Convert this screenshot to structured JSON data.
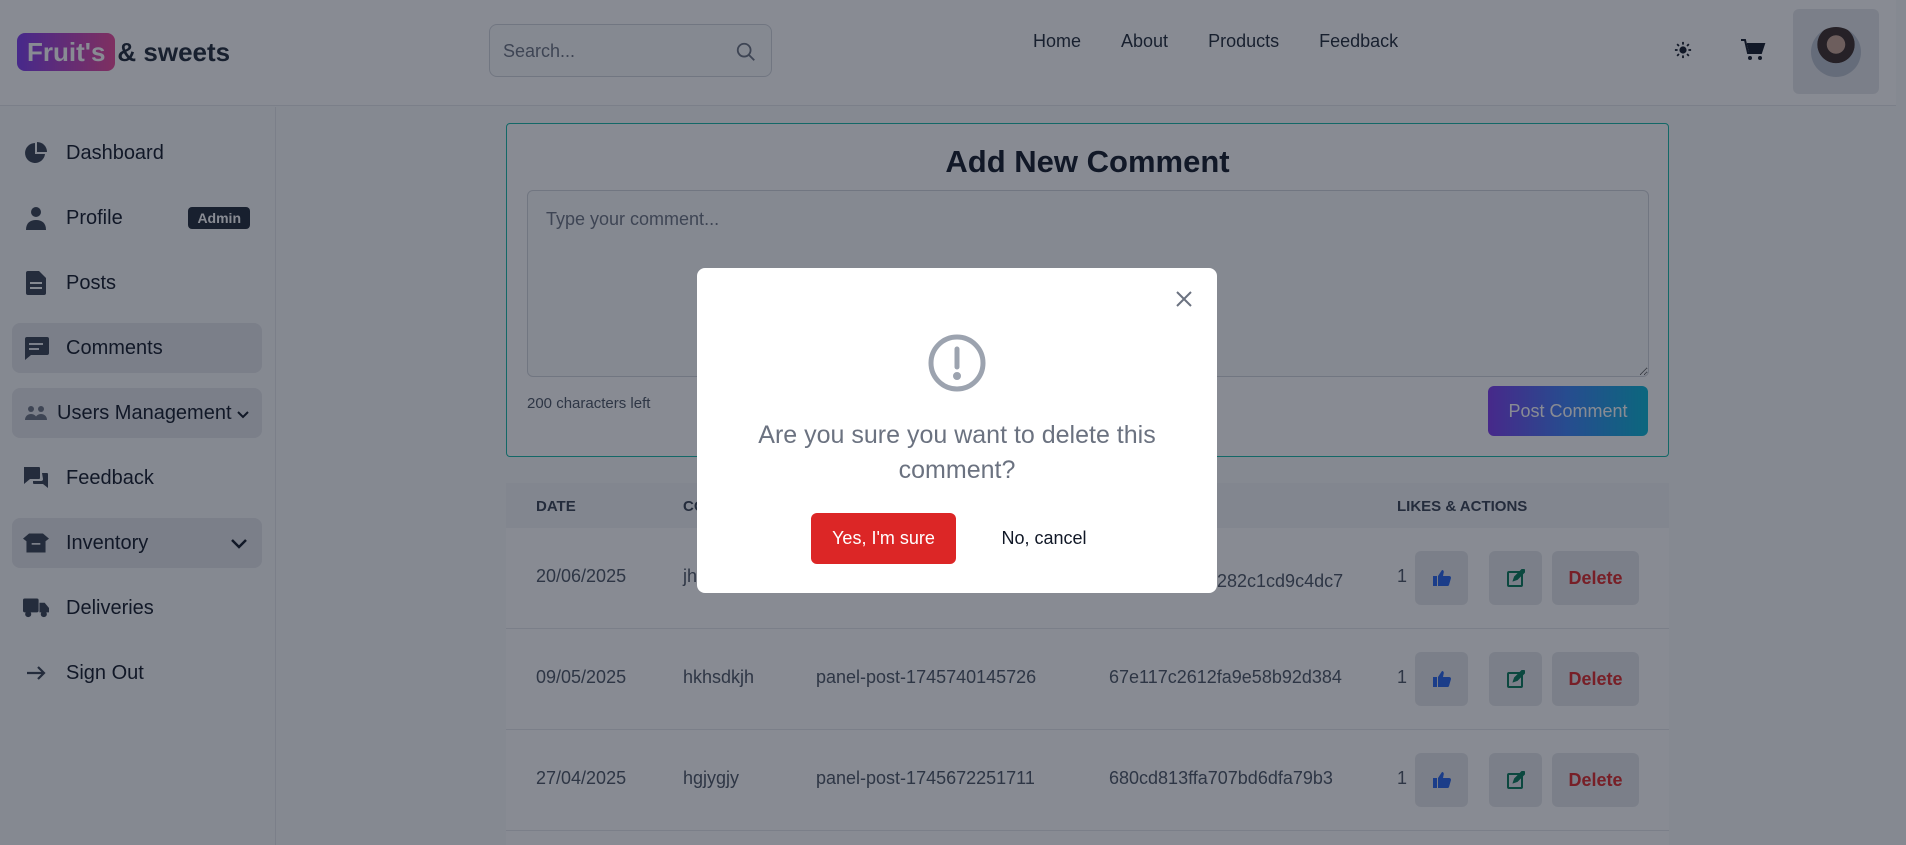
{
  "header": {
    "logo_badge": "Fruit's",
    "logo_rest": "& sweets",
    "search_placeholder": "Search...",
    "nav": [
      "Home",
      "About",
      "Products",
      "Feedback"
    ]
  },
  "sidebar": {
    "items": [
      {
        "label": "Dashboard",
        "icon": "pie-chart-icon"
      },
      {
        "label": "Profile",
        "icon": "user-icon",
        "badge": "Admin"
      },
      {
        "label": "Posts",
        "icon": "document-icon"
      },
      {
        "label": "Comments",
        "icon": "comment-icon",
        "active": true
      },
      {
        "label": "Users Management",
        "icon": "users-icon",
        "active": true
      },
      {
        "label": "Feedback",
        "icon": "chat-bubbles-icon"
      },
      {
        "label": "Inventory",
        "icon": "box-icon",
        "active": true
      },
      {
        "label": "Deliveries",
        "icon": "truck-icon"
      },
      {
        "label": "Sign Out",
        "icon": "arrow-right-icon"
      }
    ]
  },
  "comment_form": {
    "title": "Add New Comment",
    "placeholder": "Type your comment...",
    "chars_left": "200 characters left",
    "post_label": "Post Comment"
  },
  "table": {
    "headers": {
      "date": "DATE",
      "comment": "CO",
      "likes_actions": "LIKES & ACTIONS"
    },
    "rows": [
      {
        "date": "20/06/2025",
        "comment": "jh",
        "post": "",
        "id": "282c1cd9c4dc7",
        "likes": "1"
      },
      {
        "date": "09/05/2025",
        "comment": "hkhsdkjh",
        "post": "panel-post-1745740145726",
        "id": "67e117c2612fa9e58b92d384",
        "likes": "1"
      },
      {
        "date": "27/04/2025",
        "comment": "hgjygjy",
        "post": "panel-post-1745672251711",
        "id": "680cd813ffa707bd6dfa79b3",
        "likes": "1"
      }
    ],
    "delete_label": "Delete"
  },
  "modal": {
    "message": "Are you sure you want to delete this comment?",
    "confirm_label": "Yes, I'm sure",
    "cancel_label": "No, cancel"
  },
  "colors": {
    "accent_purple": "#7c3aed",
    "danger": "#dc2626",
    "teal_border": "#14b8a6",
    "like_blue": "#2563eb",
    "edit_green": "#047857"
  }
}
